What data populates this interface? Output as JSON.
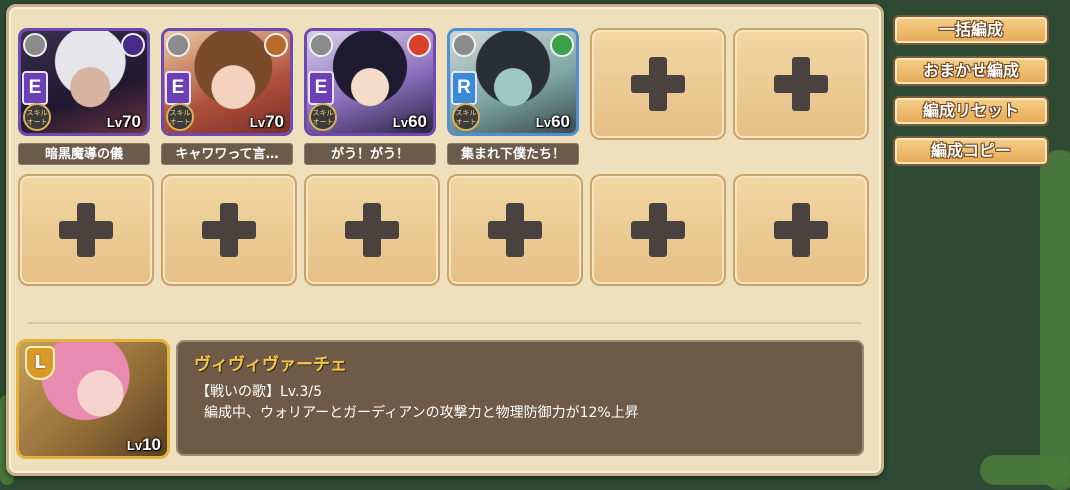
{
  "buttons": {
    "bulk": "一括編成",
    "auto": "おまかせ編成",
    "reset": "編成リセット",
    "copy": "編成コピー"
  },
  "units": [
    {
      "rarity": "E",
      "level_prefix": "Lv",
      "level": "70",
      "skill": "暗黒魔導の儀",
      "skill_badge": "スキル\nオート",
      "element": "dark",
      "class_icon": "swirl-icon"
    },
    {
      "rarity": "E",
      "level_prefix": "Lv",
      "level": "70",
      "skill": "キャワワって言…",
      "skill_badge": "スキル\nオート",
      "element": "earth",
      "class_icon": "wing-icon"
    },
    {
      "rarity": "E",
      "level_prefix": "Lv",
      "level": "60",
      "skill": "がう！がう！",
      "skill_badge": "スキル\nオート",
      "element": "fire",
      "class_icon": "crosshair-icon"
    },
    {
      "rarity": "R",
      "level_prefix": "Lv",
      "level": "60",
      "skill": "集まれ下僕たち！",
      "skill_badge": "スキル\nオート",
      "element": "wind",
      "class_icon": "horn-icon"
    }
  ],
  "leader": {
    "badge": "L",
    "level_prefix": "Lv",
    "level": "10",
    "name": "ヴィヴィヴァーチェ",
    "skill_line": "【戦いの歌】Lv.3/5",
    "skill_desc": "編成中、ウォリアーとガーディアンの攻撃力と物理防御力が12%上昇"
  },
  "colors": {
    "rarity_e": "#6b3fb5",
    "rarity_r": "#3a8ad8",
    "slot_fill": "#e9c68c",
    "accent_gold": "#f1c64a"
  }
}
